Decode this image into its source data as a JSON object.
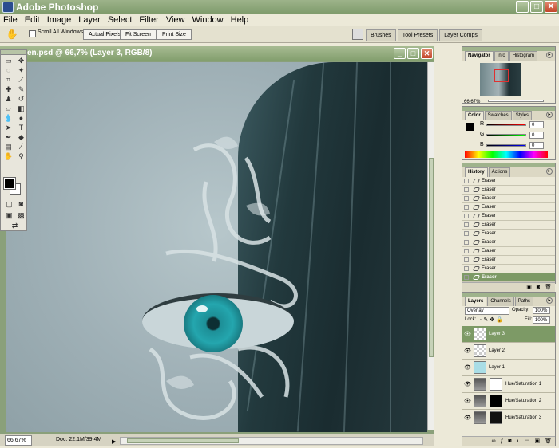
{
  "app": {
    "title": "Adobe Photoshop",
    "min": "_",
    "max": "□",
    "close": "✕"
  },
  "menu": [
    "File",
    "Edit",
    "Image",
    "Layer",
    "Select",
    "Filter",
    "View",
    "Window",
    "Help"
  ],
  "options": {
    "tool_icon": "hand-icon",
    "scroll_all": "Scroll All Windows",
    "actual_pixels": "Actual Pixels",
    "fit_screen": "Fit Screen",
    "print_size": "Print Size",
    "well_tabs": [
      "Brushes",
      "Tool Presets",
      "Layer Comps"
    ]
  },
  "document": {
    "title": "en.psd @ 66,7% (Layer 3, RGB/8)",
    "zoom": "66.67%",
    "doc_size": "Doc: 22.1M/39.4M"
  },
  "navigator": {
    "tabs": [
      "Navigator",
      "Info",
      "Histogram"
    ],
    "zoom": "66.67%"
  },
  "color": {
    "tabs": [
      "Color",
      "Swatches",
      "Styles"
    ],
    "channels": [
      {
        "label": "R",
        "value": "0"
      },
      {
        "label": "G",
        "value": "0"
      },
      {
        "label": "B",
        "value": "0"
      }
    ]
  },
  "history": {
    "tabs": [
      "History",
      "Actions"
    ],
    "items": [
      "Eraser",
      "Eraser",
      "Eraser",
      "Eraser",
      "Eraser",
      "Eraser",
      "Eraser",
      "Eraser",
      "Eraser",
      "Eraser",
      "Eraser",
      "Eraser"
    ]
  },
  "layers": {
    "tabs": [
      "Layers",
      "Channels",
      "Paths"
    ],
    "blend_mode": "Overlay",
    "opacity_label": "Opacity:",
    "opacity": "100%",
    "lock_label": "Lock:",
    "fill_label": "Fill:",
    "fill": "100%",
    "items": [
      "Layer 3",
      "Layer 2",
      "Layer 1",
      "Hue/Saturation 1",
      "Hue/Saturation 2",
      "Hue/Saturation 3"
    ]
  },
  "colors": {
    "accent": "#7d9a66",
    "title_green": "#8aa576",
    "iris": "#24a6ae"
  }
}
